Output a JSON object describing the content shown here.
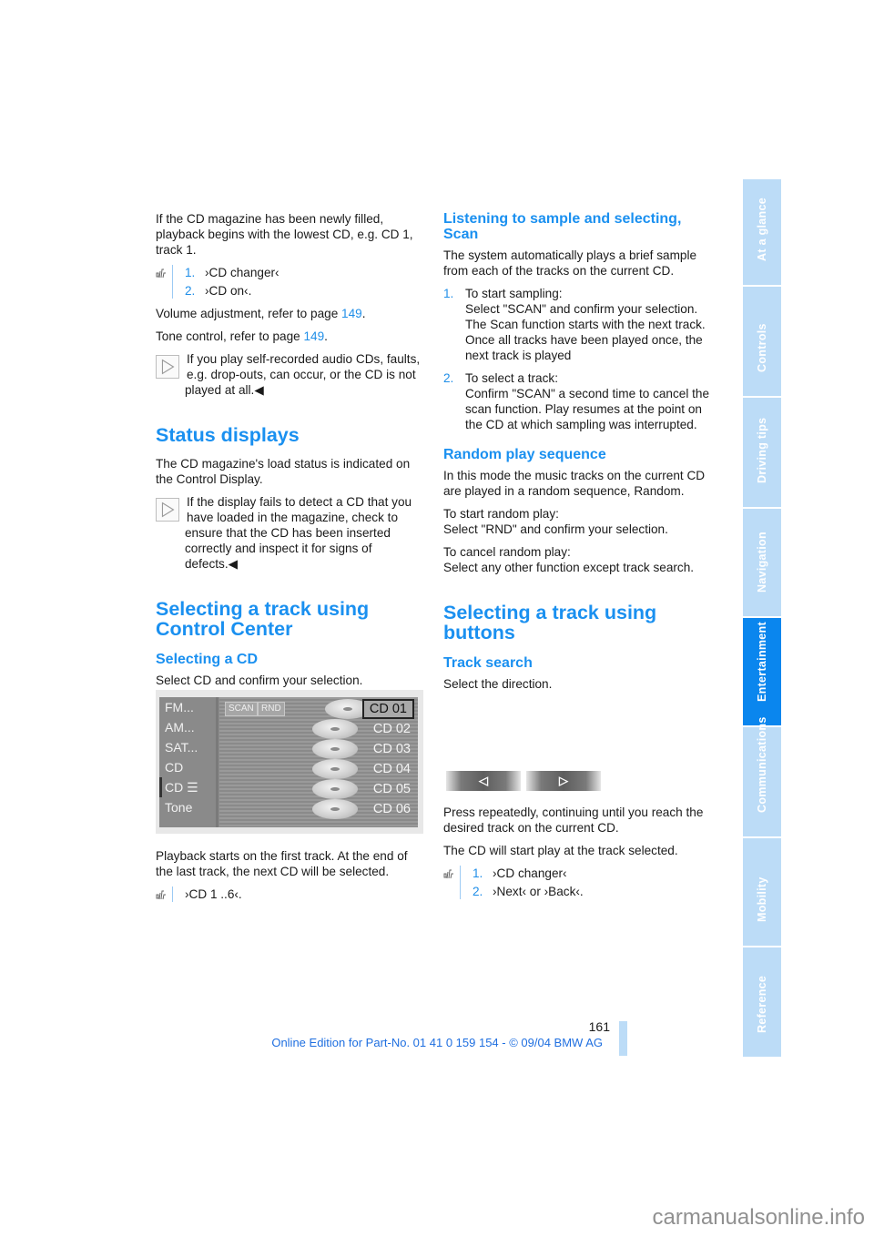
{
  "left": {
    "intro": "If the CD magazine has been newly filled, playback begins with the lowest CD, e.g. CD 1, track 1.",
    "voice1": [
      {
        "num": "1.",
        "text": "›CD changer‹"
      },
      {
        "num": "2.",
        "text": "›CD on‹."
      }
    ],
    "volume_prefix": "Volume adjustment, refer to page ",
    "volume_page": "149",
    "tone_prefix": "Tone control, refer to page ",
    "tone_page": "149",
    "note1": "If you play self-recorded audio CDs, faults, e.g. drop-outs, can occur, or the CD is not played at all.◀",
    "status_heading": "Status displays",
    "status_text": "The CD magazine's load status is indicated on the Control Display.",
    "note2": "If the display fails to detect a CD that you have loaded in the magazine, check to ensure that the CD has been inserted correctly and inspect it for signs of defects.◀",
    "cc_heading_line1": "Selecting a track using",
    "cc_heading_line2": "Control Center",
    "select_cd_heading": "Selecting a CD",
    "select_cd_text": "Select CD and confirm your selection.",
    "playback_text": "Playback starts on the first track. At the end of the last track, the next CD will be selected.",
    "voice2": "›CD 1 ..6‹."
  },
  "cd_display": {
    "menu": [
      "FM...",
      "AM...",
      "SAT...",
      "CD",
      "CD",
      "Tone"
    ],
    "menu_selected_index": 4,
    "buttons": [
      "SCAN",
      "RND"
    ],
    "cds": [
      "CD 01",
      "CD 02",
      "CD 03",
      "CD 04",
      "CD 05",
      "CD 06"
    ],
    "selected_cd_index": 0
  },
  "right": {
    "scan_heading_line1": "Listening to sample and selecting,",
    "scan_heading_line2": "Scan",
    "scan_text": "The system automatically plays a brief sample from each of the tracks on the current CD.",
    "scan_steps": [
      {
        "num": "1.",
        "lines": [
          "To start sampling:",
          "Select \"SCAN\" and confirm your selection.",
          "The Scan function starts with the next track. Once all tracks have been played once, the next track is played"
        ]
      },
      {
        "num": "2.",
        "lines": [
          "To select a track:",
          "Confirm \"SCAN\" a second time to cancel the scan function. Play resumes at the point on the CD at which sampling was interrupted."
        ]
      }
    ],
    "random_heading": "Random play sequence",
    "random_text": "In this mode the music tracks on the current CD are played in a random sequence, Random.",
    "random_start_1": "To start random play:",
    "random_start_2": "Select \"RND\" and confirm your selection.",
    "random_cancel_1": "To cancel random play:",
    "random_cancel_2": "Select any other function except track search.",
    "buttons_heading_line1": "Selecting a track using",
    "buttons_heading_line2": "buttons",
    "track_search_heading": "Track search",
    "track_search_text": "Select the direction.",
    "dir_buttons": [
      "◁",
      "▷"
    ],
    "press_text": "Press repeatedly, continuing until you reach the desired track on the current CD.",
    "start_text": "The CD will start play at the track selected.",
    "voice3": [
      {
        "num": "1.",
        "text": "›CD changer‹"
      },
      {
        "num": "2.",
        "text": "›Next‹ or ›Back‹."
      }
    ]
  },
  "side_tabs": [
    {
      "label": "At a glance",
      "active": false
    },
    {
      "label": "Controls",
      "active": false
    },
    {
      "label": "Driving tips",
      "active": false
    },
    {
      "label": "Navigation",
      "active": false
    },
    {
      "label": "Entertainment",
      "active": true
    },
    {
      "label": "Communications",
      "active": false
    },
    {
      "label": "Mobility",
      "active": false
    },
    {
      "label": "Reference",
      "active": false
    }
  ],
  "footer": {
    "page_number": "161",
    "edition": "Online Edition for Part-No. 01 41 0 159 154 - © 09/04 BMW AG",
    "watermark": "carmanualsonline.info"
  },
  "colors": {
    "accent": "#1a90f0",
    "tab": "#bcdcf7",
    "tab_active": "#0a86ee"
  }
}
